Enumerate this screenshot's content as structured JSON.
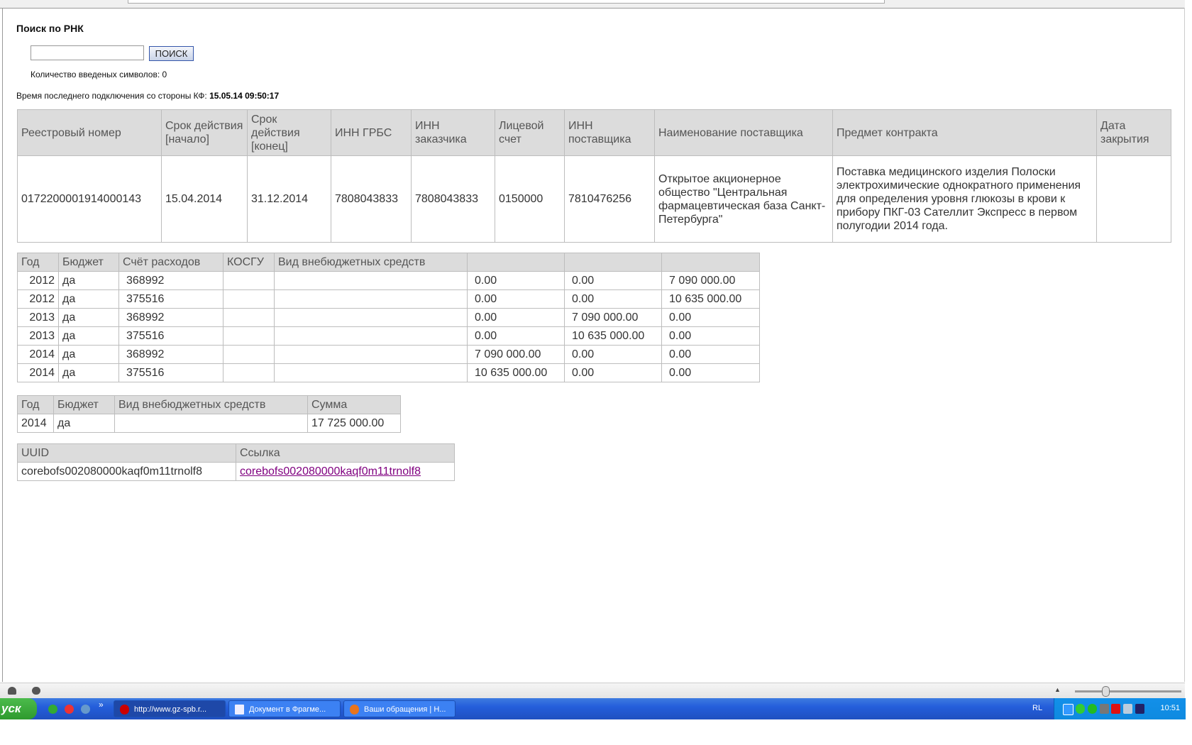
{
  "search": {
    "title": "Поиск по РНК",
    "input_value": "",
    "input_placeholder": "",
    "button_label": "ПОИСК",
    "counter_label": "Количество введеных символов: 0"
  },
  "last_connection": {
    "label": "Время последнего подключения со стороны КФ:",
    "value": "15.05.14 09:50:17"
  },
  "contract_table": {
    "headers": [
      "Реестровый номер",
      "Срок действия [начало]",
      "Срок действия [конец]",
      "ИНН ГРБС",
      "ИНН заказчика",
      "Лицевой счет",
      "ИНН поставщика",
      "Наименование поставщика",
      "Предмет контракта",
      "Дата закрытия"
    ],
    "row": [
      "0172200001914000143",
      "15.04.2014",
      "31.12.2014",
      "7808043833",
      "7808043833",
      "0150000",
      "7810476256",
      "Открытое акционерное общество \"Центральная фармацевтическая база Санкт-Петербурга\"",
      "Поставка медицинского изделия Полоски электрохимические однократного применения для определения уровня глюкозы в крови к прибору ПКГ-03 Сателлит Экспресс в первом полугодии 2014 года.",
      ""
    ]
  },
  "finance_table": {
    "headers": [
      "Год",
      "Бюджет",
      "Счёт расходов",
      "КОСГУ",
      "Вид внебюджетных средств",
      "",
      "",
      ""
    ],
    "rows": [
      [
        "2012",
        "да",
        "368992",
        "",
        "",
        "0.00",
        "0.00",
        "7 090 000.00"
      ],
      [
        "2012",
        "да",
        "375516",
        "",
        "",
        "0.00",
        "0.00",
        "10 635 000.00"
      ],
      [
        "2013",
        "да",
        "368992",
        "",
        "",
        "0.00",
        "7 090 000.00",
        "0.00"
      ],
      [
        "2013",
        "да",
        "375516",
        "",
        "",
        "0.00",
        "10 635 000.00",
        "0.00"
      ],
      [
        "2014",
        "да",
        "368992",
        "",
        "",
        "7 090 000.00",
        "0.00",
        "0.00"
      ],
      [
        "2014",
        "да",
        "375516",
        "",
        "",
        "10 635 000.00",
        "0.00",
        "0.00"
      ]
    ]
  },
  "sum_table": {
    "headers": [
      "Год",
      "Бюджет",
      "Вид внебюджетных средств",
      "Сумма"
    ],
    "rows": [
      [
        "2014",
        "да",
        "",
        "17 725 000.00"
      ]
    ]
  },
  "uuid_table": {
    "headers": [
      "UUID",
      "Ссылка"
    ],
    "uuid": "corebofs002080000kaqf0m11trnolf8",
    "link": "corebofs002080000kaqf0m11trnolf8",
    "link_color": "#800080"
  },
  "taskbar": {
    "start_label": "уск",
    "tasks": [
      {
        "label": "http://www.gz-spb.r...",
        "icon": "opera-icon",
        "active": true
      },
      {
        "label": "Документ в Фрагме...",
        "icon": "word-icon",
        "active": false
      },
      {
        "label": "Ваши обращения | Н...",
        "icon": "firefox-icon",
        "active": false
      }
    ],
    "language": "RL",
    "clock": "10:51"
  }
}
